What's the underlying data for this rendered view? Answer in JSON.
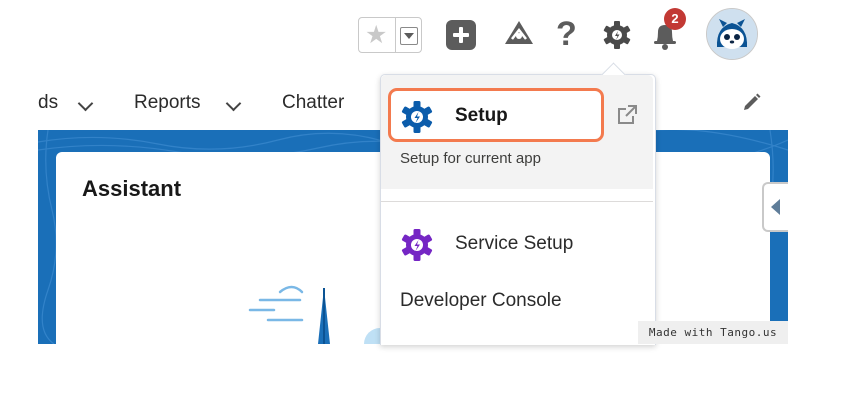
{
  "header": {
    "favorites_star": "★",
    "help_glyph": "?",
    "notification_count": "2",
    "colors": {
      "badge": "#c23934",
      "icon_gray": "#5c5c5c"
    }
  },
  "nav": {
    "partial_tab_label": "ds",
    "tabs": [
      {
        "label": "Reports"
      },
      {
        "label": "Chatter"
      }
    ]
  },
  "assistant": {
    "title": "Assistant"
  },
  "setup_menu": {
    "setup_label": "Setup",
    "setup_subtitle": "Setup for current app",
    "items": [
      {
        "label": "Service Setup",
        "icon": "purple-gear-icon"
      },
      {
        "label": "Developer Console"
      }
    ],
    "colors": {
      "highlight_border": "#f37a4e",
      "setup_gear": "#0b5cab",
      "service_gear": "#7526c4"
    }
  },
  "watermark": {
    "text": "Made with Tango.us"
  },
  "colors": {
    "app_background": "#1a6fb8"
  }
}
